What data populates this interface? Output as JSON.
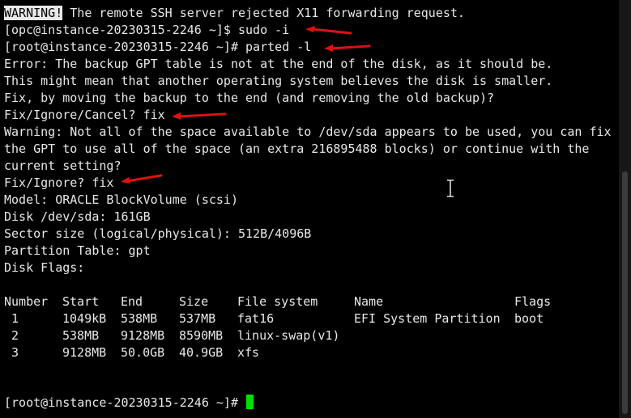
{
  "lines": {
    "l0_tag": "WARNING!",
    "l0_rest": " The remote SSH server rejected X11 forwarding request.",
    "l1": "[opc@instance-20230315-2246 ~]$ sudo -i",
    "l2": "[root@instance-20230315-2246 ~]# parted -l",
    "l3": "Error: The backup GPT table is not at the end of the disk, as it should be.",
    "l4": "This might mean that another operating system believes the disk is smaller.",
    "l5": "Fix, by moving the backup to the end (and removing the old backup)?",
    "l6": "Fix/Ignore/Cancel? fix",
    "l7": "Warning: Not all of the space available to /dev/sda appears to be used, you can fix",
    "l8": "the GPT to use all of the space (an extra 216895488 blocks) or continue with the",
    "l9": "current setting?",
    "l10": "Fix/Ignore? fix",
    "l11": "Model: ORACLE BlockVolume (scsi)",
    "l12": "Disk /dev/sda: 161GB",
    "l13": "Sector size (logical/physical): 512B/4096B",
    "l14": "Partition Table: gpt",
    "l15": "Disk Flags:",
    "prompt": "[root@instance-20230315-2246 ~]# "
  },
  "table": {
    "headers": [
      "Number",
      "Start",
      "End",
      "Size",
      "File system",
      "Name",
      "Flags"
    ],
    "rows": [
      [
        "1",
        "1049kB",
        "538MB",
        "537MB",
        "fat16",
        "EFI System Partition",
        "boot"
      ],
      [
        "2",
        "538MB",
        "9128MB",
        "8590MB",
        "linux-swap(v1)",
        "",
        ""
      ],
      [
        "3",
        "9128MB",
        "50.0GB",
        "40.9GB",
        "xfs",
        "",
        ""
      ]
    ]
  },
  "colors": {
    "background": "#000000",
    "text": "#e8e8e8",
    "cursor": "#00e000",
    "annotation_arrow": "#e01010"
  }
}
